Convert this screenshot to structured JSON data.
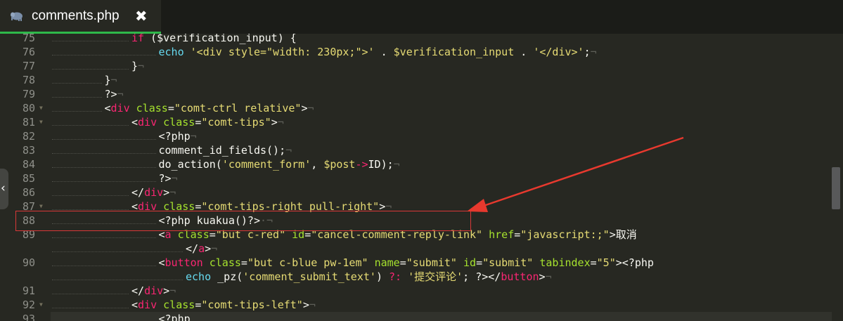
{
  "tab": {
    "label": "comments.php",
    "close_glyph": "✖",
    "icon": "elephant-php-icon"
  },
  "colors": {
    "background": "#272822",
    "accent": "#2eb84a",
    "annotation": "#d93838"
  },
  "left_handle_glyph": "‹",
  "lines": [
    {
      "num": "75",
      "fold": false,
      "indent": 4,
      "html": "<span class='t-kw'>if</span> ($verification_input) {"
    },
    {
      "num": "76",
      "fold": false,
      "indent": 5,
      "html": "<span class='t-fn'>echo</span> <span class='t-str'>'&lt;div style=\"width: 230px;\"&gt;'</span> . <span class='t-var'>$verification_input</span> . <span class='t-str'>'&lt;/div&gt;'</span>;<span class='t-ws'>¬</span>"
    },
    {
      "num": "77",
      "fold": false,
      "indent": 4,
      "html": "}<span class='t-ws'>¬</span>"
    },
    {
      "num": "78",
      "fold": false,
      "indent": 3,
      "html": "}<span class='t-ws'>¬</span>"
    },
    {
      "num": "79",
      "fold": false,
      "indent": 3,
      "html": "?&gt;<span class='t-ws'>¬</span>"
    },
    {
      "num": "80",
      "fold": true,
      "indent": 3,
      "html": "&lt;<span class='t-kw'>div</span> <span class='t-attr'>class</span>=<span class='t-str'>\"comt-ctrl relative\"</span>&gt;<span class='t-ws'>¬</span>"
    },
    {
      "num": "81",
      "fold": true,
      "indent": 4,
      "html": "&lt;<span class='t-kw'>div</span> <span class='t-attr'>class</span>=<span class='t-str'>\"comt-tips\"</span>&gt;<span class='t-ws'>¬</span>"
    },
    {
      "num": "82",
      "fold": false,
      "indent": 5,
      "html": "&lt;?php<span class='t-ws'>¬</span>"
    },
    {
      "num": "83",
      "fold": false,
      "indent": 5,
      "html": "comment_id_fields();<span class='t-ws'>¬</span>"
    },
    {
      "num": "84",
      "fold": false,
      "indent": 5,
      "html": "do_action(<span class='t-str'>'comment_form'</span>, <span class='t-var'>$post</span><span class='t-kw'>-&gt;</span>ID);<span class='t-ws'>¬</span>"
    },
    {
      "num": "85",
      "fold": false,
      "indent": 5,
      "html": "?&gt;<span class='t-ws'>¬</span>"
    },
    {
      "num": "86",
      "fold": false,
      "indent": 4,
      "html": "&lt;/<span class='t-kw'>div</span>&gt;<span class='t-ws'>¬</span>"
    },
    {
      "num": "87",
      "fold": true,
      "indent": 4,
      "html": "&lt;<span class='t-kw'>div</span> <span class='t-attr'>class</span>=<span class='t-str'>\"comt-tips-right pull-right\"</span>&gt;<span class='t-ws'>¬</span>"
    },
    {
      "num": "88",
      "fold": false,
      "indent": 5,
      "html": "&lt;?php kuakua()?&gt;<span class='t-ws'>·¬</span>"
    },
    {
      "num": "89",
      "fold": false,
      "indent": 5,
      "html": "&lt;<span class='t-kw'>a</span> <span class='t-attr'>class</span>=<span class='t-str'>\"but c-red\"</span> <span class='t-attr'>id</span>=<span class='t-str'>\"cancel-comment-reply-link\"</span> <span class='t-attr'>href</span>=<span class='t-str'>\"javascript:;\"</span>&gt;取消"
    },
    {
      "num": "",
      "fold": false,
      "indent": 6,
      "html": "&lt;/<span class='t-kw'>a</span>&gt;<span class='t-ws'>¬</span>"
    },
    {
      "num": "90",
      "fold": false,
      "indent": 5,
      "html": "&lt;<span class='t-kw'>button</span> <span class='t-attr'>class</span>=<span class='t-str'>\"but c-blue pw-1em\"</span> <span class='t-attr'>name</span>=<span class='t-str'>\"submit\"</span> <span class='t-attr'>id</span>=<span class='t-str'>\"submit\"</span> <span class='t-attr'>tabindex</span>=<span class='t-str'>\"5\"</span>&gt;&lt;?php"
    },
    {
      "num": "",
      "fold": false,
      "indent": 6,
      "html": "<span class='t-fn'>echo</span> _pz(<span class='t-str'>'comment_submit_text'</span>) <span class='t-kw'>?:</span> <span class='t-str'>'提交评论'</span>; ?&gt;&lt;/<span class='t-kw'>button</span>&gt;<span class='t-ws'>¬</span>"
    },
    {
      "num": "91",
      "fold": false,
      "indent": 4,
      "html": "&lt;/<span class='t-kw'>div</span>&gt;<span class='t-ws'>¬</span>"
    },
    {
      "num": "92",
      "fold": true,
      "indent": 4,
      "html": "&lt;<span class='t-kw'>div</span> <span class='t-attr'>class</span>=<span class='t-str'>\"comt-tips-left\"</span>&gt;<span class='t-ws'>¬</span>"
    },
    {
      "num": "93",
      "fold": false,
      "indent": 5,
      "html": "&lt;?php"
    }
  ]
}
